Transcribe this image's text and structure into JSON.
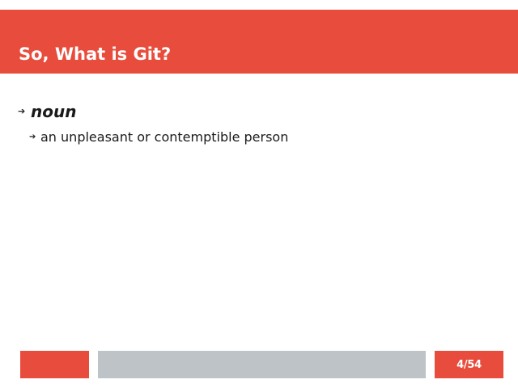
{
  "slide": {
    "title": "So, What is Git?",
    "bullets": [
      {
        "icon": "arrow-right-icon",
        "text": "noun",
        "children": [
          {
            "icon": "arrow-right-icon",
            "text": "an unpleasant or contemptible person"
          }
        ]
      }
    ]
  },
  "footer": {
    "page_number": "4/54"
  },
  "colors": {
    "accent": "#e74c3c",
    "footer_bar": "#bec3c7",
    "background": "#ffffff",
    "text": "#1a1a1a"
  }
}
